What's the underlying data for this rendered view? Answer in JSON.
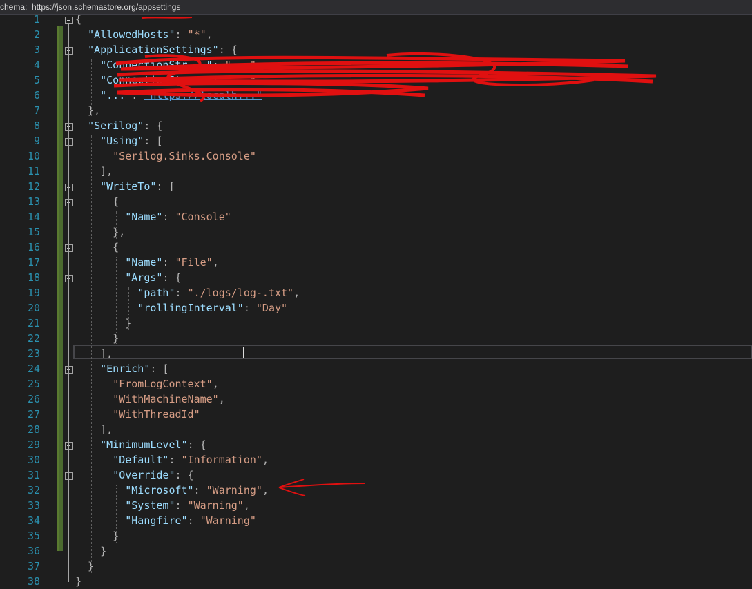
{
  "schema": {
    "label": "chema:",
    "url": "https://json.schemastore.org/appsettings"
  },
  "colors": {
    "background": "#1e1e1e",
    "line_number": "#2b91af",
    "json_key": "#9cdcfe",
    "json_string": "#d69d85",
    "link": "#569cd6",
    "annotation_red": "#e01010",
    "change_marker": "#4b6a2e"
  },
  "editor": {
    "lines": [
      {
        "n": "1",
        "text": "{"
      },
      {
        "n": "2",
        "text": "  \"AllowedHosts\": \"*\","
      },
      {
        "n": "3",
        "text": "  \"ApplicationSettings\": {"
      },
      {
        "n": "4",
        "text": "    \"ConnectionStr...\": \"...\""
      },
      {
        "n": "5",
        "text": "    \"ConnectionStr...\": \"...\","
      },
      {
        "n": "6",
        "text": "    \"...\": \"https://localh...\""
      },
      {
        "n": "7",
        "text": "  },"
      },
      {
        "n": "8",
        "text": "  \"Serilog\": {"
      },
      {
        "n": "9",
        "text": "    \"Using\": ["
      },
      {
        "n": "10",
        "text": "      \"Serilog.Sinks.Console\""
      },
      {
        "n": "11",
        "text": "    ],"
      },
      {
        "n": "12",
        "text": "    \"WriteTo\": ["
      },
      {
        "n": "13",
        "text": "      {"
      },
      {
        "n": "14",
        "text": "        \"Name\": \"Console\""
      },
      {
        "n": "15",
        "text": "      },"
      },
      {
        "n": "16",
        "text": "      {"
      },
      {
        "n": "17",
        "text": "        \"Name\": \"File\","
      },
      {
        "n": "18",
        "text": "        \"Args\": {"
      },
      {
        "n": "19",
        "text": "          \"path\": \"./logs/log-.txt\","
      },
      {
        "n": "20",
        "text": "          \"rollingInterval\": \"Day\""
      },
      {
        "n": "21",
        "text": "        }"
      },
      {
        "n": "22",
        "text": "      }"
      },
      {
        "n": "23",
        "text": "    ],"
      },
      {
        "n": "24",
        "text": "    \"Enrich\": ["
      },
      {
        "n": "25",
        "text": "      \"FromLogContext\","
      },
      {
        "n": "26",
        "text": "      \"WithMachineName\","
      },
      {
        "n": "27",
        "text": "      \"WithThreadId\""
      },
      {
        "n": "28",
        "text": "    ],"
      },
      {
        "n": "29",
        "text": "    \"MinimumLevel\": {"
      },
      {
        "n": "30",
        "text": "      \"Default\": \"Information\","
      },
      {
        "n": "31",
        "text": "      \"Override\": {"
      },
      {
        "n": "32",
        "text": "        \"Microsoft\": \"Warning\","
      },
      {
        "n": "33",
        "text": "        \"System\": \"Warning\","
      },
      {
        "n": "34",
        "text": "        \"Hangfire\": \"Warning\""
      },
      {
        "n": "35",
        "text": "      }"
      },
      {
        "n": "36",
        "text": "    }"
      },
      {
        "n": "37",
        "text": "  }"
      },
      {
        "n": "38",
        "text": "}"
      }
    ]
  }
}
